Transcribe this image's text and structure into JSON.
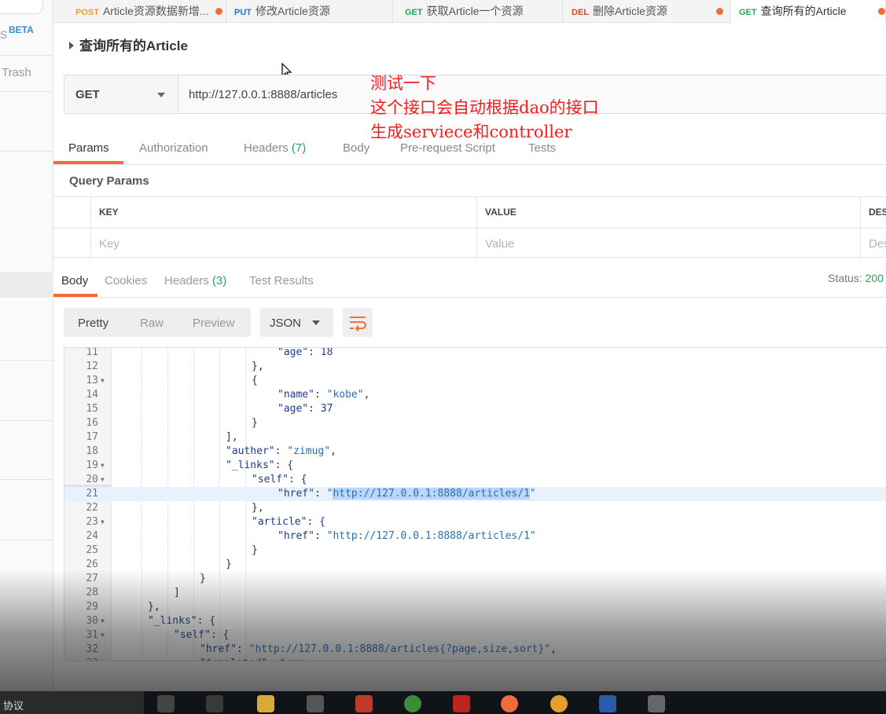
{
  "sidebar": {
    "beta": "BETA",
    "s": "S",
    "trash": "Trash"
  },
  "tabs": [
    {
      "method": "POST",
      "title": "Article资源数据新增...",
      "dirty": true
    },
    {
      "method": "PUT",
      "title": "修改Article资源",
      "dirty": false
    },
    {
      "method": "GET",
      "title": "获取Article一个资源",
      "dirty": false
    },
    {
      "method": "DEL",
      "title": "删除Article资源",
      "dirty": true
    },
    {
      "method": "GET",
      "title": "查询所有的Article",
      "dirty": true
    }
  ],
  "request": {
    "title": "查询所有的Article",
    "method": "GET",
    "url": "http://127.0.0.1:8888/articles"
  },
  "annotation": {
    "line1": "测试一下",
    "line2": "这个接口会自动根据dao的接口",
    "line3": "生成serviece和controller"
  },
  "request_tabs": {
    "params": "Params",
    "authorization": "Authorization",
    "headers": "Headers",
    "headers_count": "(7)",
    "body": "Body",
    "prerequest": "Pre-request Script",
    "tests": "Tests"
  },
  "query_params": {
    "title": "Query Params",
    "col_key": "KEY",
    "col_value": "VALUE",
    "col_desc": "DESC",
    "key_placeholder": "Key",
    "value_placeholder": "Value",
    "desc_placeholder": "Des"
  },
  "response_tabs": {
    "body": "Body",
    "cookies": "Cookies",
    "headers": "Headers",
    "headers_count": "(3)",
    "test_results": "Test Results",
    "status_label": "Status:",
    "status_value": "200"
  },
  "format": {
    "pretty": "Pretty",
    "raw": "Raw",
    "preview": "Preview",
    "type": "JSON"
  },
  "code_lines": [
    {
      "n": "11",
      "fold": false,
      "indent": 6,
      "text": "\"age\": 18"
    },
    {
      "n": "12",
      "fold": false,
      "indent": 5,
      "text": "},"
    },
    {
      "n": "13",
      "fold": true,
      "indent": 5,
      "text": "{"
    },
    {
      "n": "14",
      "fold": false,
      "indent": 6,
      "text": "\"name\": \"kobe\","
    },
    {
      "n": "15",
      "fold": false,
      "indent": 6,
      "text": "\"age\": 37"
    },
    {
      "n": "16",
      "fold": false,
      "indent": 5,
      "text": "}"
    },
    {
      "n": "17",
      "fold": false,
      "indent": 4,
      "text": "],"
    },
    {
      "n": "18",
      "fold": false,
      "indent": 4,
      "text": "\"auther\": \"zimug\","
    },
    {
      "n": "19",
      "fold": true,
      "indent": 4,
      "text": "\"_links\": {"
    },
    {
      "n": "20",
      "fold": true,
      "indent": 5,
      "text": "\"self\": {"
    },
    {
      "n": "21",
      "fold": false,
      "indent": 6,
      "text": "\"href\": \"http://127.0.0.1:8888/articles/1\"",
      "highlight": true
    },
    {
      "n": "22",
      "fold": false,
      "indent": 5,
      "text": "},"
    },
    {
      "n": "23",
      "fold": true,
      "indent": 5,
      "text": "\"article\": {"
    },
    {
      "n": "24",
      "fold": false,
      "indent": 6,
      "text": "\"href\": \"http://127.0.0.1:8888/articles/1\""
    },
    {
      "n": "25",
      "fold": false,
      "indent": 5,
      "text": "}"
    },
    {
      "n": "26",
      "fold": false,
      "indent": 4,
      "text": "}"
    },
    {
      "n": "27",
      "fold": false,
      "indent": 3,
      "text": "}"
    },
    {
      "n": "28",
      "fold": false,
      "indent": 2,
      "text": "]"
    },
    {
      "n": "29",
      "fold": false,
      "indent": 1,
      "text": "},"
    },
    {
      "n": "30",
      "fold": true,
      "indent": 1,
      "text": "\"_links\": {"
    },
    {
      "n": "31",
      "fold": true,
      "indent": 2,
      "text": "\"self\": {"
    },
    {
      "n": "32",
      "fold": false,
      "indent": 3,
      "text": "\"href\": \"http://127.0.0.1:8888/articles{?page,size,sort}\","
    },
    {
      "n": "33",
      "fold": false,
      "indent": 3,
      "text": "\"templated\": true"
    }
  ],
  "taskbar": {
    "left_text": "协议"
  },
  "colors": {
    "accent": "#f26b3a",
    "green": "#27a35e",
    "annotation": "#ff1a1a"
  }
}
